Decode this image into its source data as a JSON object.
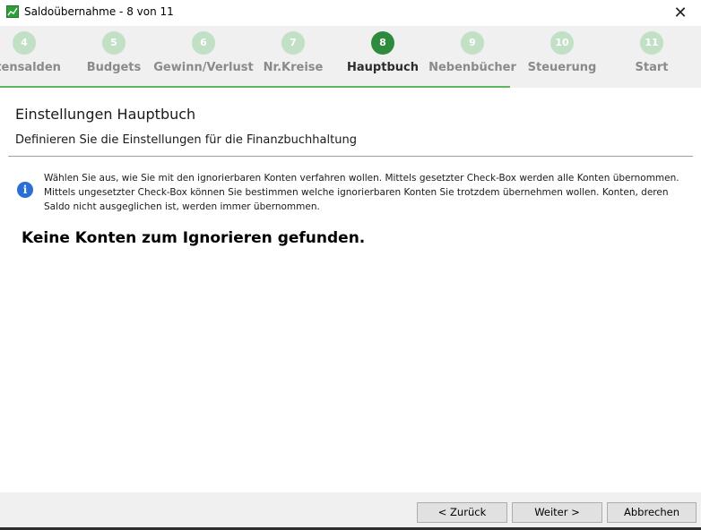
{
  "window": {
    "title": "Saldoübernahme - 8 von 11",
    "close_symbol": "✕"
  },
  "steps": [
    {
      "number": "4",
      "label": "ntensalden",
      "active": false
    },
    {
      "number": "5",
      "label": "Budgets",
      "active": false
    },
    {
      "number": "6",
      "label": "Gewinn/Verlust",
      "active": false
    },
    {
      "number": "7",
      "label": "Nr.Kreise",
      "active": false
    },
    {
      "number": "8",
      "label": "Hauptbuch",
      "active": true
    },
    {
      "number": "9",
      "label": "Nebenbücher",
      "active": false
    },
    {
      "number": "10",
      "label": "Steuerung",
      "active": false
    },
    {
      "number": "11",
      "label": "Start",
      "active": false
    }
  ],
  "page": {
    "title": "Einstellungen Hauptbuch",
    "subtitle": "Definieren Sie die Einstellungen für die Finanzbuchhaltung",
    "info_icon_glyph": "i",
    "info_text": "Wählen Sie aus, wie Sie mit den ignorierbaren Konten verfahren wollen. Mittels gesetzter Check-Box werden alle Konten übernommen. Mittels ungesetzter Check-Box können Sie bestimmen welche ignorierbaren Konten Sie trotzdem übernehmen wollen. Konten, deren Saldo nicht ausgeglichen ist, werden immer übernommen.",
    "empty_message": "Keine Konten zum Ignorieren gefunden."
  },
  "footer": {
    "back_label": "< Zurück",
    "next_label": "Weiter >",
    "cancel_label": "Abbrechen"
  },
  "colors": {
    "active_step": "#2e8b3e",
    "inactive_step": "#c2e0c6",
    "progress_underline": "#5cb85c",
    "info_icon": "#2a6fd6"
  },
  "icons": {
    "app": "chart-app-icon",
    "close": "close-icon",
    "info": "info-icon"
  }
}
